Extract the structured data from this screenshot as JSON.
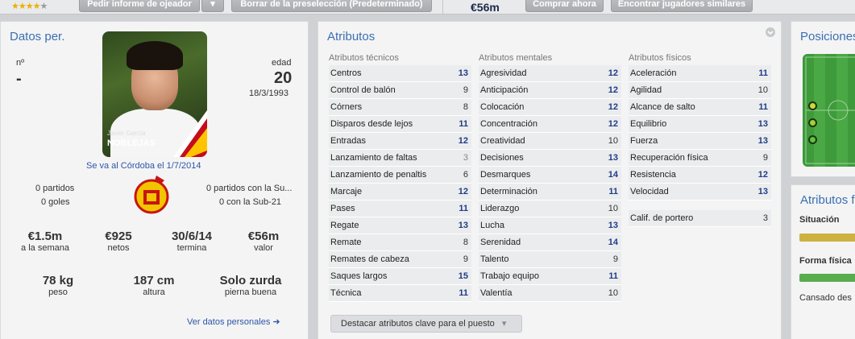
{
  "topbar": {
    "rating_stars_filled": 4,
    "rating_stars_total": 5,
    "scout_report_button": "Pedir informe de ojeador",
    "remove_shortlist_button": "Borrar de la preselección (Predeterminado)",
    "value": "€56m",
    "buy_now_button": "Comprar ahora",
    "find_similar_button": "Encontrar jugadores similares"
  },
  "personal": {
    "title": "Datos per.",
    "number_label": "nº",
    "number_value": "-",
    "age_label": "edad",
    "age_value": "20",
    "birth_date": "18/3/1993",
    "photo_name_small": "Javier  García",
    "photo_name": "NOBLEJAS",
    "transfer_note": "Se va al Córdoba el 1/7/2014",
    "matches": "0 partidos",
    "goals": "0 goles",
    "u21_matches": "0 partidos con la Su...",
    "u21_goals": "0 con la Sub-21",
    "wage_value": "€1.5m",
    "wage_label": "a la semana",
    "net_value": "€925",
    "net_label": "netos",
    "contract_value": "30/6/14",
    "contract_label": "termina",
    "market_value": "€56m",
    "market_label": "valor",
    "weight_value": "78 kg",
    "weight_label": "peso",
    "height_value": "187 cm",
    "height_label": "altura",
    "foot_value": "Solo zurda",
    "foot_label": "pierna buena",
    "more_link": "Ver datos personales"
  },
  "attributes": {
    "title": "Atributos",
    "technical_header": "Atributos técnicos",
    "mental_header": "Atributos mentales",
    "physical_header": "Atributos físicos",
    "technical": [
      {
        "name": "Centros",
        "value": "13"
      },
      {
        "name": "Control de balón",
        "value": "9"
      },
      {
        "name": "Córners",
        "value": "8"
      },
      {
        "name": "Disparos desde lejos",
        "value": "11"
      },
      {
        "name": "Entradas",
        "value": "12"
      },
      {
        "name": "Lanzamiento de faltas",
        "value": "3"
      },
      {
        "name": "Lanzamiento de penaltis",
        "value": "6"
      },
      {
        "name": "Marcaje",
        "value": "12"
      },
      {
        "name": "Pases",
        "value": "11"
      },
      {
        "name": "Regate",
        "value": "13"
      },
      {
        "name": "Remate",
        "value": "8"
      },
      {
        "name": "Remates de cabeza",
        "value": "9"
      },
      {
        "name": "Saques largos",
        "value": "15"
      },
      {
        "name": "Técnica",
        "value": "11"
      }
    ],
    "mental": [
      {
        "name": "Agresividad",
        "value": "12"
      },
      {
        "name": "Anticipación",
        "value": "12"
      },
      {
        "name": "Colocación",
        "value": "12"
      },
      {
        "name": "Concentración",
        "value": "12"
      },
      {
        "name": "Creatividad",
        "value": "10"
      },
      {
        "name": "Decisiones",
        "value": "13"
      },
      {
        "name": "Desmarques",
        "value": "14"
      },
      {
        "name": "Determinación",
        "value": "11"
      },
      {
        "name": "Liderazgo",
        "value": "10"
      },
      {
        "name": "Lucha",
        "value": "13"
      },
      {
        "name": "Serenidad",
        "value": "14"
      },
      {
        "name": "Talento",
        "value": "9"
      },
      {
        "name": "Trabajo equipo",
        "value": "11"
      },
      {
        "name": "Valentía",
        "value": "10"
      }
    ],
    "physical": [
      {
        "name": "Aceleración",
        "value": "11"
      },
      {
        "name": "Agilidad",
        "value": "10"
      },
      {
        "name": "Alcance de salto",
        "value": "11"
      },
      {
        "name": "Equilibrio",
        "value": "13"
      },
      {
        "name": "Fuerza",
        "value": "13"
      },
      {
        "name": "Recuperación física",
        "value": "9"
      },
      {
        "name": "Resistencia",
        "value": "12"
      },
      {
        "name": "Velocidad",
        "value": "13"
      }
    ],
    "goalkeeper_label": "Calif. de portero",
    "goalkeeper_value": "3",
    "highlight_button": "Destacar atributos clave para el puesto"
  },
  "positions": {
    "title": "Posiciones"
  },
  "physical_status": {
    "title": "Atributos f",
    "situation_label": "Situación",
    "fitness_label": "Forma física",
    "tired_label": "Cansado des"
  },
  "colors": {
    "accent_blue": "#3a6fb0",
    "high_value": "#1e3c87",
    "situation_bar": "#cdb241",
    "fitness_bar": "#58ad4e"
  }
}
